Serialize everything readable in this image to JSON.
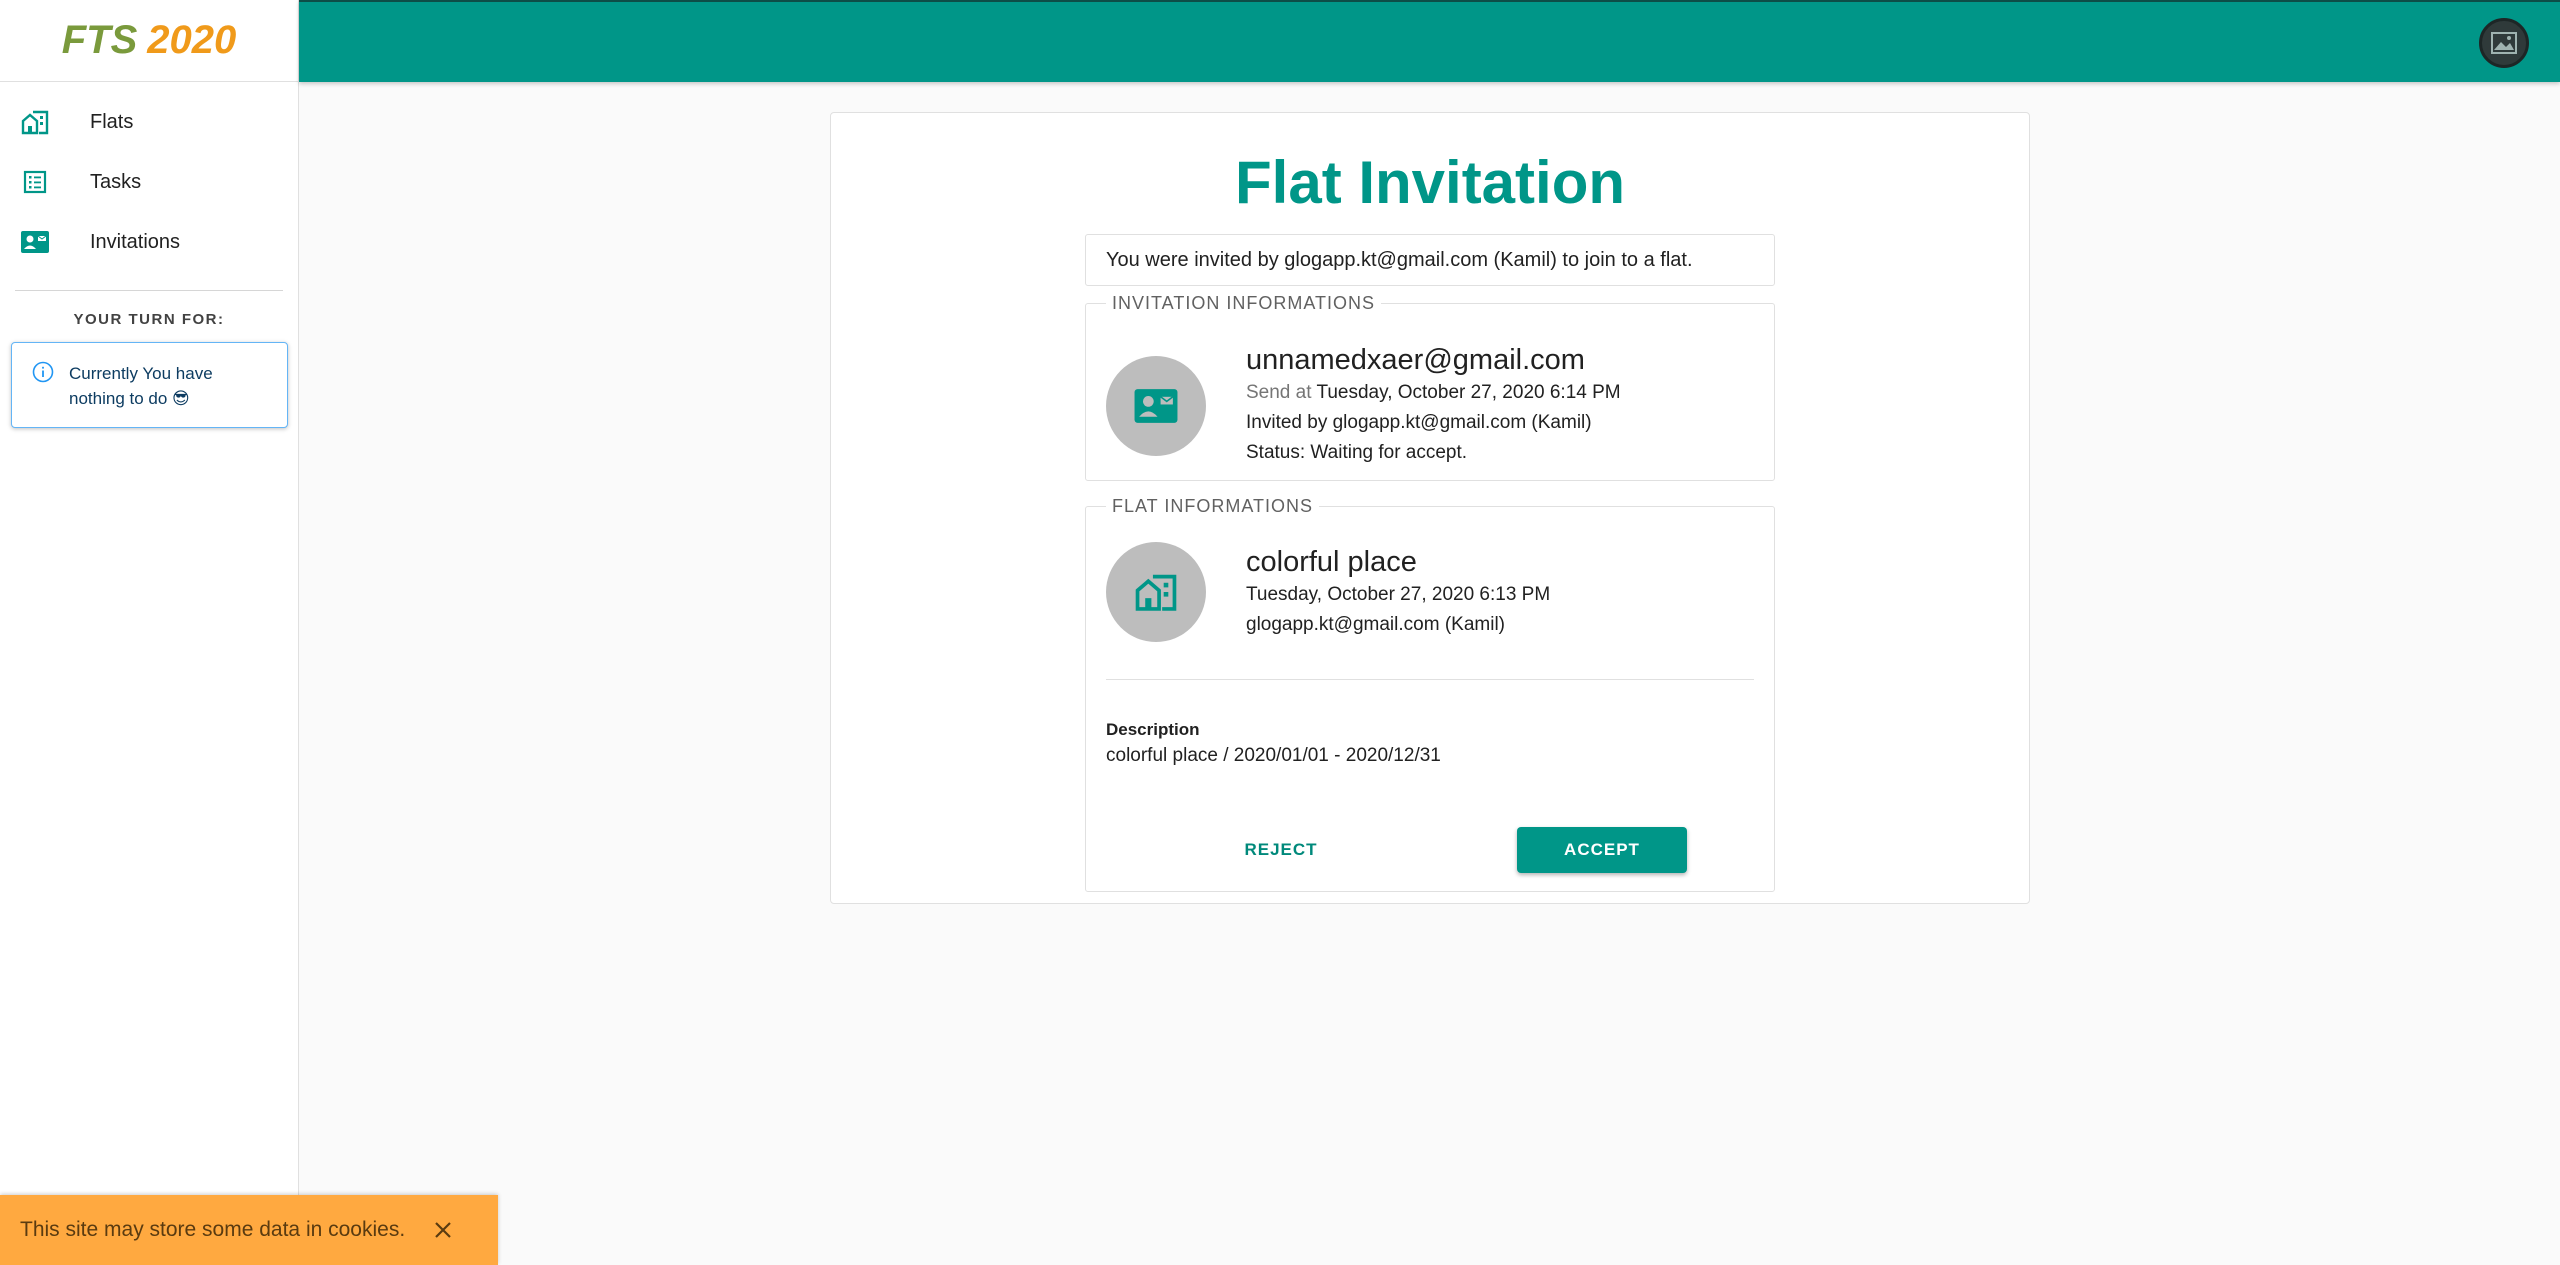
{
  "app": {
    "logo_part1": "FTS",
    "logo_part2": "2020"
  },
  "sidebar": {
    "items": [
      {
        "label": "Flats",
        "icon": "building-icon"
      },
      {
        "label": "Tasks",
        "icon": "list-icon"
      },
      {
        "label": "Invitations",
        "icon": "contact-card-icon"
      }
    ],
    "turn_title": "YOUR TURN FOR:",
    "info_text": "Currently You have nothing to do 😎"
  },
  "card": {
    "title": "Flat Invitation",
    "notice": "You were invited by glogapp.kt@gmail.com (Kamil) to join to a flat.",
    "invitation": {
      "legend": "INVITATION INFORMATIONS",
      "email": "unnamedxaer@gmail.com",
      "send_prefix": "Send at",
      "send_date": "Tuesday, October 27, 2020 6:14 PM",
      "invited_by": "Invited by glogapp.kt@gmail.com (Kamil)",
      "status": "Status: Waiting for accept."
    },
    "flat": {
      "legend": "FLAT INFORMATIONS",
      "name": "colorful place",
      "date": "Tuesday, October 27, 2020 6:13 PM",
      "owner": "glogapp.kt@gmail.com (Kamil)",
      "description_label": "Description",
      "description": "colorful place / 2020/01/01 - 2020/12/31"
    },
    "reject_label": "REJECT",
    "accept_label": "ACCEPT"
  },
  "cookie": {
    "text": "This site may store some data in cookies."
  },
  "colors": {
    "primary": "#009688",
    "logo_green": "#7a9a3c",
    "logo_orange": "#f09a1a",
    "cookie_bg": "#ffa940"
  }
}
